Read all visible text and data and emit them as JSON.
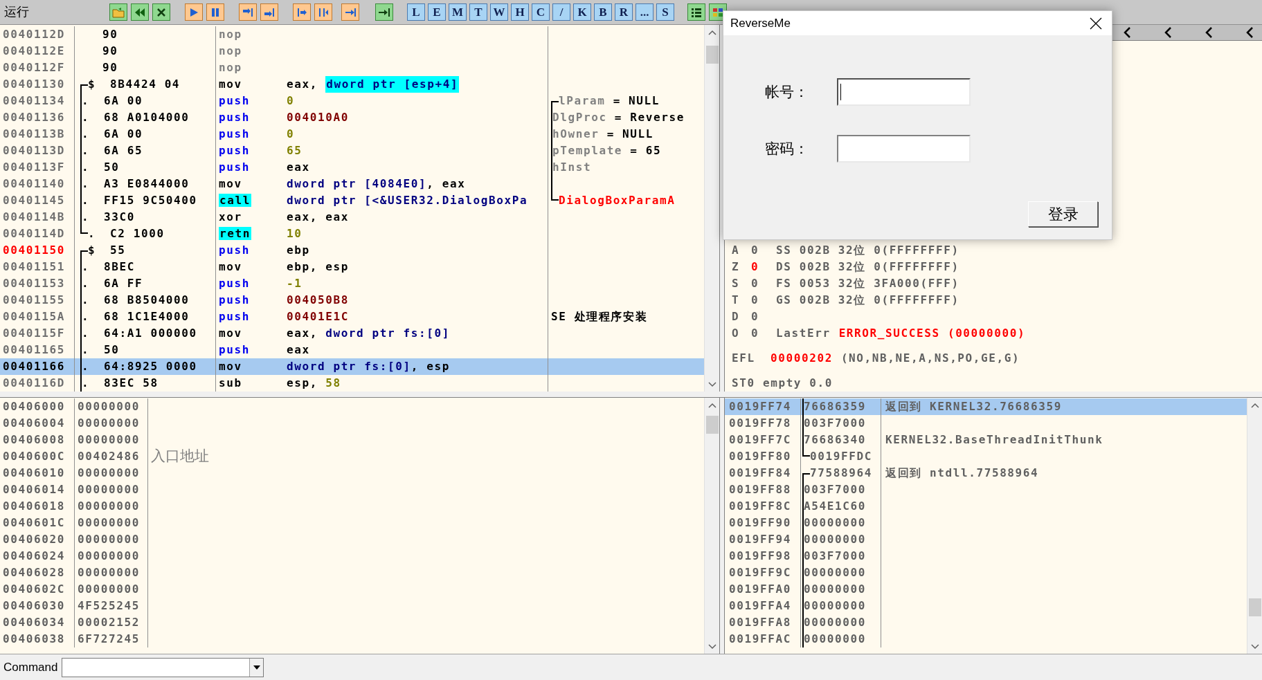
{
  "toolbar": {
    "status": "运行",
    "letter_buttons": [
      "L",
      "E",
      "M",
      "T",
      "W",
      "H",
      "C",
      "/",
      "K",
      "B",
      "R",
      "...",
      "S"
    ]
  },
  "disassembly": {
    "rows": [
      {
        "address": "0040112D",
        "marked": false,
        "selected": false,
        "hex": "90",
        "mnemonic": {
          "text": "nop",
          "kind": "filler"
        },
        "operands": []
      },
      {
        "address": "0040112E",
        "marked": false,
        "selected": false,
        "hex": "90",
        "mnemonic": {
          "text": "nop",
          "kind": "filler"
        },
        "operands": []
      },
      {
        "address": "0040112F",
        "marked": false,
        "selected": false,
        "hex": "90",
        "mnemonic": {
          "text": "nop",
          "kind": "filler"
        },
        "operands": []
      },
      {
        "address": "00401130",
        "marked": false,
        "selected": false,
        "bracket": {
          "kind": "start"
        },
        "marker": "$",
        "hex": "8B4424 04",
        "mnemonic": {
          "text": "mov",
          "kind": "plain"
        },
        "operands": [
          {
            "text": "eax, ",
            "kind": "plain"
          },
          {
            "text": "dword ptr [esp+4]",
            "kind": "mem_hl"
          }
        ]
      },
      {
        "address": "00401134",
        "marked": false,
        "selected": false,
        "bracket": {
          "kind": "mid"
        },
        "marker": ".",
        "hex": "6A 00",
        "mnemonic": {
          "text": "push",
          "kind": "push"
        },
        "operands": [
          {
            "text": "0",
            "kind": "const"
          }
        ],
        "comment_bracket": {
          "kind": "start"
        },
        "comment": [
          {
            "text": "lParam",
            "kind": "name"
          },
          {
            "text": " = NULL",
            "kind": "plain"
          }
        ]
      },
      {
        "address": "00401136",
        "marked": false,
        "selected": false,
        "bracket": {
          "kind": "mid"
        },
        "marker": ".",
        "hex": "68 A0104000",
        "mnemonic": {
          "text": "push",
          "kind": "push"
        },
        "operands": [
          {
            "text": "004010A0",
            "kind": "addr"
          }
        ],
        "comment_bracket": {
          "kind": "mid"
        },
        "comment": [
          {
            "text": "DlgProc",
            "kind": "name"
          },
          {
            "text": " = Reverse",
            "kind": "plain"
          }
        ]
      },
      {
        "address": "0040113B",
        "marked": false,
        "selected": false,
        "bracket": {
          "kind": "mid"
        },
        "marker": ".",
        "hex": "6A 00",
        "mnemonic": {
          "text": "push",
          "kind": "push"
        },
        "operands": [
          {
            "text": "0",
            "kind": "const"
          }
        ],
        "comment_bracket": {
          "kind": "mid"
        },
        "comment": [
          {
            "text": "hOwner",
            "kind": "name"
          },
          {
            "text": " = NULL",
            "kind": "plain"
          }
        ]
      },
      {
        "address": "0040113D",
        "marked": false,
        "selected": false,
        "bracket": {
          "kind": "mid"
        },
        "marker": ".",
        "hex": "6A 65",
        "mnemonic": {
          "text": "push",
          "kind": "push"
        },
        "operands": [
          {
            "text": "65",
            "kind": "const"
          }
        ],
        "comment_bracket": {
          "kind": "mid"
        },
        "comment": [
          {
            "text": "pTemplate",
            "kind": "name"
          },
          {
            "text": " = 65",
            "kind": "plain"
          }
        ]
      },
      {
        "address": "0040113F",
        "marked": false,
        "selected": false,
        "bracket": {
          "kind": "mid"
        },
        "marker": ".",
        "hex": "50",
        "mnemonic": {
          "text": "push",
          "kind": "push"
        },
        "operands": [
          {
            "text": "eax",
            "kind": "plain"
          }
        ],
        "comment_bracket": {
          "kind": "mid"
        },
        "comment": [
          {
            "text": "hInst",
            "kind": "name"
          }
        ]
      },
      {
        "address": "00401140",
        "marked": false,
        "selected": false,
        "bracket": {
          "kind": "mid"
        },
        "marker": ".",
        "hex": "A3 E0844000",
        "mnemonic": {
          "text": "mov",
          "kind": "plain"
        },
        "operands": [
          {
            "text": "dword ptr [4084E0]",
            "kind": "mem"
          },
          {
            "text": ", eax",
            "kind": "plain"
          }
        ],
        "comment_bracket": {
          "kind": "mid"
        }
      },
      {
        "address": "00401145",
        "marked": false,
        "selected": false,
        "bracket": {
          "kind": "mid"
        },
        "marker": ".",
        "hex": "FF15 9C50400",
        "mnemonic": {
          "text": "call",
          "kind": "highlight"
        },
        "operands": [
          {
            "text": "dword ptr [<&USER32.DialogBoxPa",
            "kind": "mem"
          }
        ],
        "comment_bracket": {
          "kind": "end"
        },
        "comment": [
          {
            "text": "DialogBoxParamA",
            "kind": "api"
          }
        ]
      },
      {
        "address": "0040114B",
        "marked": false,
        "selected": false,
        "bracket": {
          "kind": "mid"
        },
        "marker": ".",
        "hex": "33C0",
        "mnemonic": {
          "text": "xor",
          "kind": "plain"
        },
        "operands": [
          {
            "text": "eax, eax",
            "kind": "plain"
          }
        ]
      },
      {
        "address": "0040114D",
        "marked": false,
        "selected": false,
        "bracket": {
          "kind": "end"
        },
        "marker": ".",
        "hex": "C2 1000",
        "mnemonic": {
          "text": "retn",
          "kind": "highlight"
        },
        "operands": [
          {
            "text": "10",
            "kind": "const"
          }
        ]
      },
      {
        "address": "00401150",
        "marked": true,
        "selected": false,
        "bracket": {
          "kind": "start"
        },
        "marker": "$",
        "hex": "55",
        "mnemonic": {
          "text": "push",
          "kind": "push"
        },
        "operands": [
          {
            "text": "ebp",
            "kind": "plain"
          }
        ]
      },
      {
        "address": "00401151",
        "marked": false,
        "selected": false,
        "bracket": {
          "kind": "mid"
        },
        "marker": ".",
        "hex": "8BEC",
        "mnemonic": {
          "text": "mov",
          "kind": "plain"
        },
        "operands": [
          {
            "text": "ebp, esp",
            "kind": "plain"
          }
        ]
      },
      {
        "address": "00401153",
        "marked": false,
        "selected": false,
        "bracket": {
          "kind": "mid"
        },
        "marker": ".",
        "hex": "6A FF",
        "mnemonic": {
          "text": "push",
          "kind": "push"
        },
        "operands": [
          {
            "text": "-1",
            "kind": "const"
          }
        ]
      },
      {
        "address": "00401155",
        "marked": false,
        "selected": false,
        "bracket": {
          "kind": "mid"
        },
        "marker": ".",
        "hex": "68 B8504000",
        "mnemonic": {
          "text": "push",
          "kind": "push"
        },
        "operands": [
          {
            "text": "004050B8",
            "kind": "addr"
          }
        ]
      },
      {
        "address": "0040115A",
        "marked": false,
        "selected": false,
        "bracket": {
          "kind": "mid"
        },
        "marker": ".",
        "hex": "68 1C1E4000",
        "mnemonic": {
          "text": "push",
          "kind": "push"
        },
        "operands": [
          {
            "text": "00401E1C",
            "kind": "addr"
          }
        ],
        "comment": [
          {
            "text": "SE 处理程序安装",
            "kind": "plain"
          }
        ]
      },
      {
        "address": "0040115F",
        "marked": false,
        "selected": false,
        "bracket": {
          "kind": "mid"
        },
        "marker": ".",
        "hex": "64:A1 000000",
        "mnemonic": {
          "text": "mov",
          "kind": "plain"
        },
        "operands": [
          {
            "text": "eax, ",
            "kind": "plain"
          },
          {
            "text": "dword ptr fs:[0]",
            "kind": "mem"
          }
        ]
      },
      {
        "address": "00401165",
        "marked": false,
        "selected": false,
        "bracket": {
          "kind": "mid"
        },
        "marker": ".",
        "hex": "50",
        "mnemonic": {
          "text": "push",
          "kind": "push"
        },
        "operands": [
          {
            "text": "eax",
            "kind": "plain"
          }
        ]
      },
      {
        "address": "00401166",
        "marked": false,
        "selected": true,
        "bracket": {
          "kind": "mid"
        },
        "marker": ".",
        "hex": "64:8925 0000",
        "mnemonic": {
          "text": "mov",
          "kind": "plain"
        },
        "operands": [
          {
            "text": "dword ptr fs:[0]",
            "kind": "mem"
          },
          {
            "text": ", esp",
            "kind": "plain"
          }
        ]
      },
      {
        "address": "0040116D",
        "marked": false,
        "selected": false,
        "bracket": {
          "kind": "mid"
        },
        "marker": ".",
        "hex": "83EC 58",
        "mnemonic": {
          "text": "sub",
          "kind": "plain"
        },
        "operands": [
          {
            "text": "esp, ",
            "kind": "plain"
          },
          {
            "text": "58",
            "kind": "const"
          }
        ]
      }
    ]
  },
  "registers": {
    "flags": [
      {
        "flag": "A",
        "bit": "0",
        "changed": false,
        "detail": [
          {
            "text": "SS 002B 32位 0(FFFFFFFF)",
            "kind": "plain"
          }
        ]
      },
      {
        "flag": "Z",
        "bit": "0",
        "changed": true,
        "detail": [
          {
            "text": "DS 002B 32位 0(FFFFFFFF)",
            "kind": "plain"
          }
        ]
      },
      {
        "flag": "S",
        "bit": "0",
        "changed": false,
        "detail": [
          {
            "text": "FS 0053 32位 3FA000(FFF)",
            "kind": "plain"
          }
        ]
      },
      {
        "flag": "T",
        "bit": "0",
        "changed": false,
        "detail": [
          {
            "text": "GS 002B 32位 0(FFFFFFFF)",
            "kind": "plain"
          }
        ]
      },
      {
        "flag": "D",
        "bit": "0",
        "changed": false
      },
      {
        "flag": "O",
        "bit": "0",
        "changed": false,
        "detail": [
          {
            "text": "LastErr",
            "kind": "plain"
          },
          {
            "text": "ERROR_SUCCESS (00000000)",
            "kind": "alert"
          }
        ]
      }
    ],
    "efl": {
      "label": "EFL",
      "value": "00000202",
      "flags": "(NO,NB,NE,A,NS,PO,GE,G)"
    },
    "fpu": "ST0 empty 0.0"
  },
  "dialog": {
    "title": "ReverseMe",
    "fields": [
      {
        "label": "帐号：",
        "focused": true
      },
      {
        "label": "密码：",
        "focused": false
      }
    ],
    "button": "登录"
  },
  "dump": {
    "rows": [
      {
        "address": "00406000",
        "value": "00000000"
      },
      {
        "address": "00406004",
        "value": "00000000"
      },
      {
        "address": "00406008",
        "value": "00000000"
      },
      {
        "address": "0040600C",
        "value": "00402486",
        "comment": "入口地址"
      },
      {
        "address": "00406010",
        "value": "00000000"
      },
      {
        "address": "00406014",
        "value": "00000000"
      },
      {
        "address": "00406018",
        "value": "00000000"
      },
      {
        "address": "0040601C",
        "value": "00000000"
      },
      {
        "address": "00406020",
        "value": "00000000"
      },
      {
        "address": "00406024",
        "value": "00000000"
      },
      {
        "address": "00406028",
        "value": "00000000"
      },
      {
        "address": "0040602C",
        "value": "00000000"
      },
      {
        "address": "00406030",
        "value": "4F525245"
      },
      {
        "address": "00406034",
        "value": "00002152"
      },
      {
        "address": "00406038",
        "value": "6F727245"
      }
    ]
  },
  "stack": {
    "rows": [
      {
        "address": "0019FF74",
        "value": "76686359",
        "selected": true,
        "bracket": {
          "kind": "mid"
        },
        "comment": "返回到 KERNEL32.76686359"
      },
      {
        "address": "0019FF78",
        "value": "003F7000",
        "selected": false,
        "bracket": {
          "kind": "mid"
        }
      },
      {
        "address": "0019FF7C",
        "value": "76686340",
        "selected": false,
        "bracket": {
          "kind": "mid"
        },
        "comment": "KERNEL32.BaseThreadInitThunk"
      },
      {
        "address": "0019FF80",
        "value": "0019FFDC",
        "selected": false,
        "bracket": {
          "kind": "end"
        }
      },
      {
        "address": "0019FF84",
        "value": "77588964",
        "selected": false,
        "bracket": {
          "kind": "start"
        },
        "comment": "返回到 ntdll.77588964"
      },
      {
        "address": "0019FF88",
        "value": "003F7000",
        "selected": false,
        "bracket": {
          "kind": "mid"
        }
      },
      {
        "address": "0019FF8C",
        "value": "A54E1C60",
        "selected": false,
        "bracket": {
          "kind": "mid"
        }
      },
      {
        "address": "0019FF90",
        "value": "00000000",
        "selected": false,
        "bracket": {
          "kind": "mid"
        }
      },
      {
        "address": "0019FF94",
        "value": "00000000",
        "selected": false,
        "bracket": {
          "kind": "mid"
        }
      },
      {
        "address": "0019FF98",
        "value": "003F7000",
        "selected": false,
        "bracket": {
          "kind": "mid"
        }
      },
      {
        "address": "0019FF9C",
        "value": "00000000",
        "selected": false,
        "bracket": {
          "kind": "mid"
        }
      },
      {
        "address": "0019FFA0",
        "value": "00000000",
        "selected": false,
        "bracket": {
          "kind": "mid"
        }
      },
      {
        "address": "0019FFA4",
        "value": "00000000",
        "selected": false,
        "bracket": {
          "kind": "mid"
        }
      },
      {
        "address": "0019FFA8",
        "value": "00000000",
        "selected": false,
        "bracket": {
          "kind": "mid"
        }
      },
      {
        "address": "0019FFAC",
        "value": "00000000",
        "selected": false,
        "bracket": {
          "kind": "mid"
        }
      }
    ]
  },
  "command_bar": {
    "label": "Command"
  }
}
